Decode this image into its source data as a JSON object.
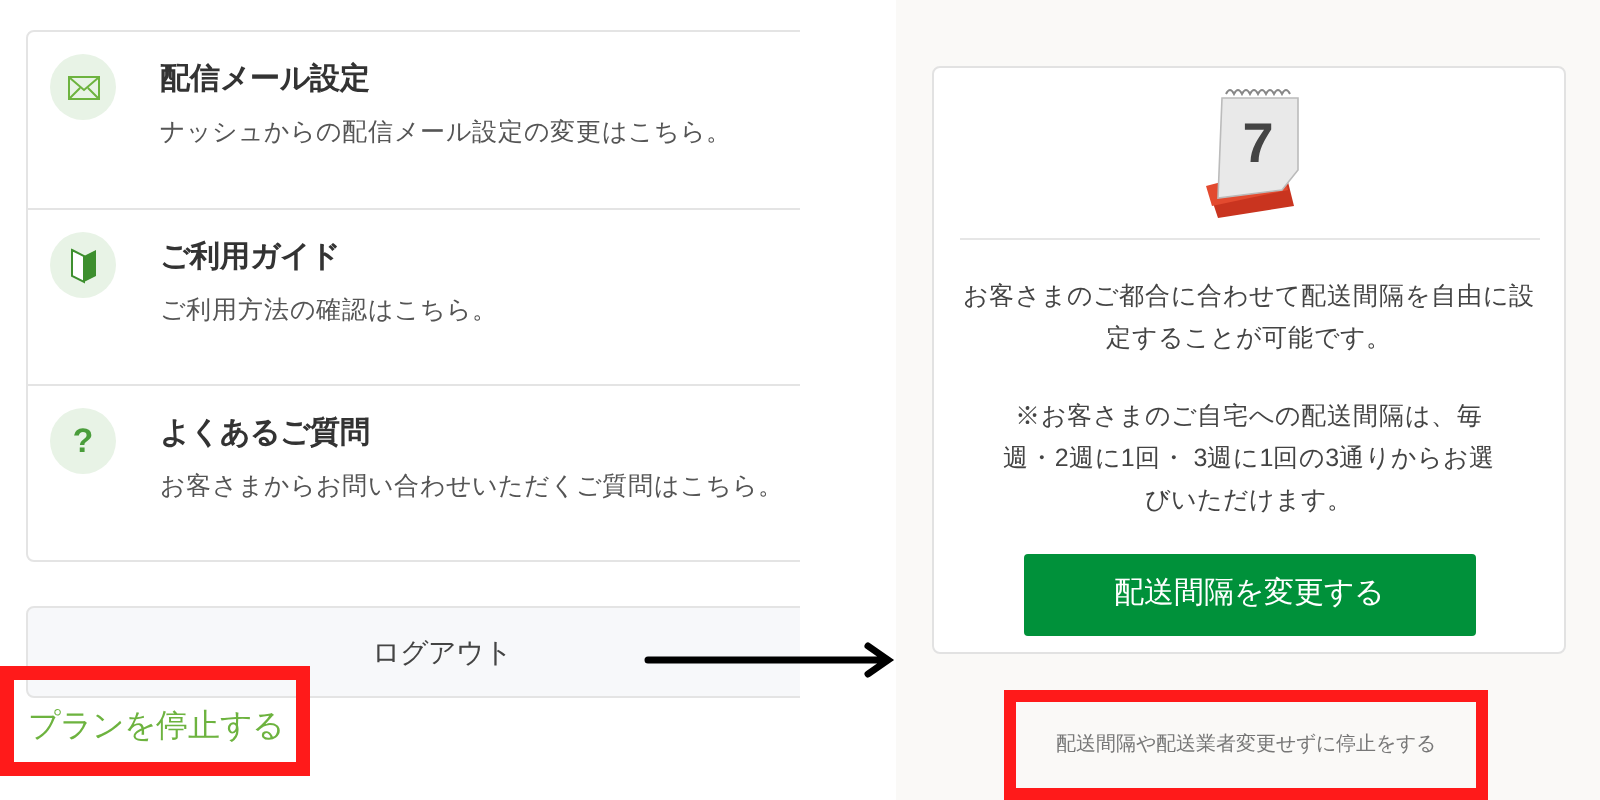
{
  "left_screen": {
    "menu_items": [
      {
        "kind": "mail",
        "title": "配信メール設定",
        "description": "ナッシュからの配信メール設定の変更はこちら。"
      },
      {
        "kind": "guide",
        "title": "ご利用ガイド",
        "description": "ご利用方法の確認はこちら。"
      },
      {
        "kind": "faq",
        "icon_text": "?",
        "title": "よくあるご質問",
        "description": "お客さまからお問い合わせいただくご質問はこちら。"
      }
    ],
    "logout_button": "ログアウト",
    "stop_plan_link": {
      "label": "プランを停止する",
      "highlighted": true
    }
  },
  "right_screen": {
    "calendar_day": "7",
    "description": [
      "お客さまのご都合に合わせて配送間隔を自由に設定することが可能です。",
      "※お客さまのご自宅への配送間隔は、毎週・2週に1回・ 3週に1回の3通りからお選びいただけます。"
    ],
    "change_interval_button": "配送間隔を変更する",
    "stop_link": {
      "label": "配送間隔や配送業者変更せずに停止をする",
      "highlighted": true
    }
  }
}
